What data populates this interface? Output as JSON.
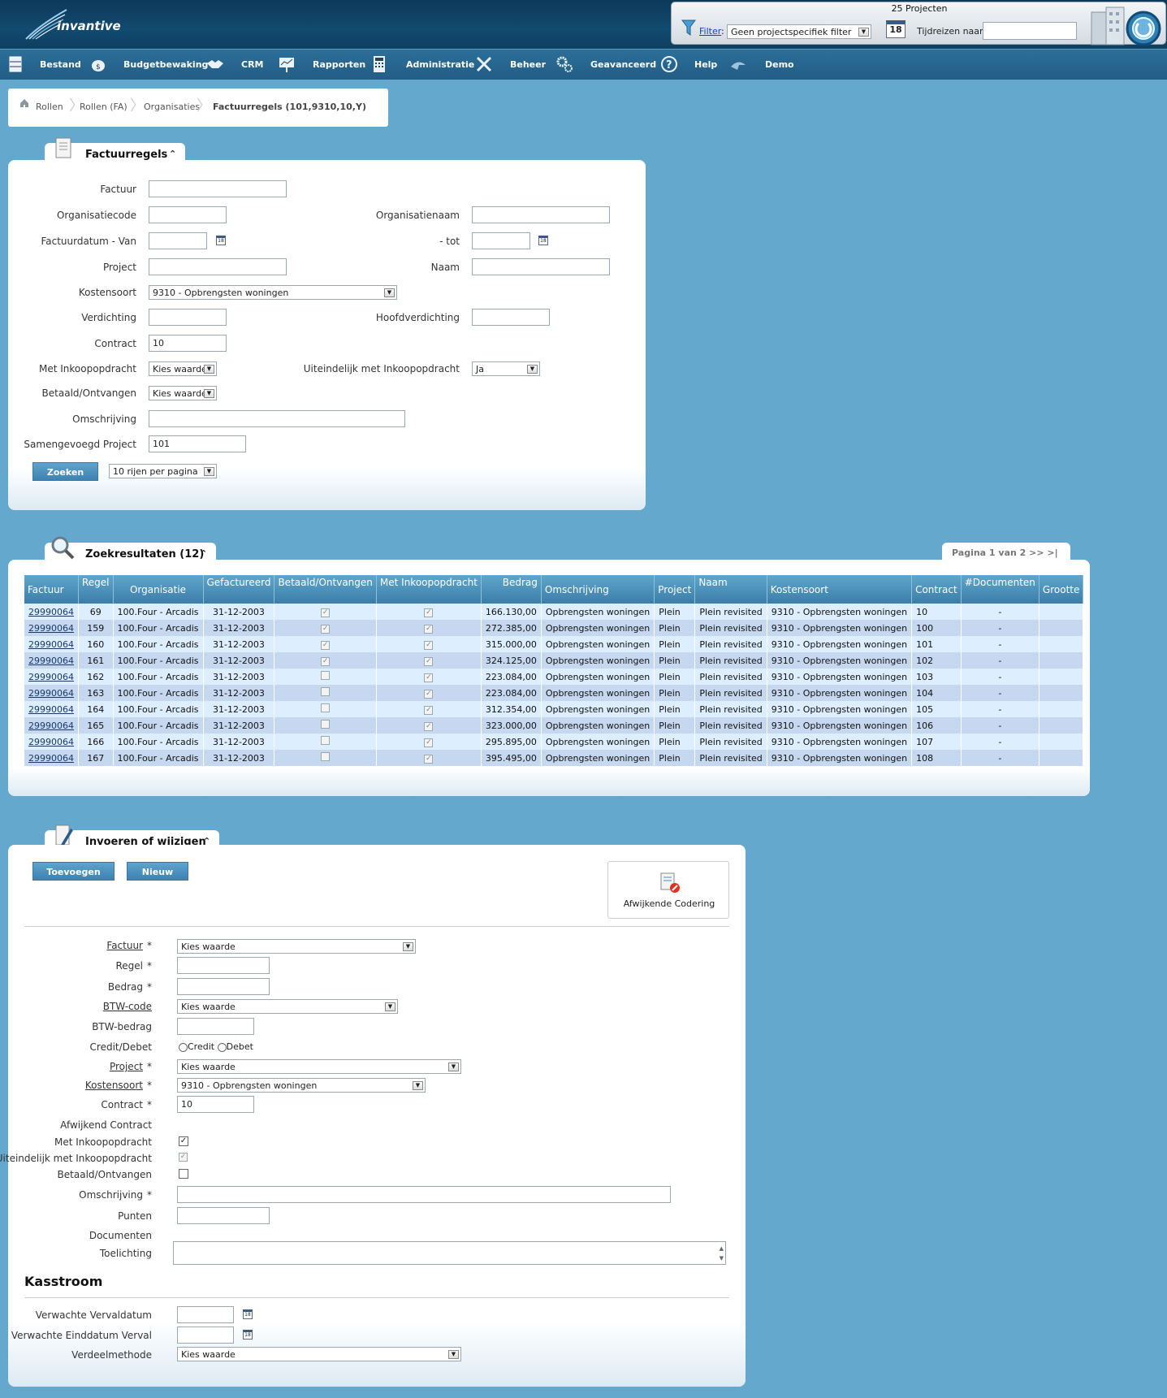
{
  "header": {
    "logo_text": "invantive",
    "project_count": "25 Projecten",
    "filter_link": "Filter",
    "filter_colon": ":",
    "filter_value": "Geen projectspecifiek filter",
    "calendar_day": "18",
    "timetravel_label": "Tijdreizen naar:"
  },
  "nav": {
    "items": [
      "Bestand",
      "Budgetbewaking",
      "CRM",
      "Rapporten",
      "Administratie",
      "Beheer",
      "Geavanceerd",
      "Help",
      "Demo"
    ]
  },
  "breadcrumb": {
    "items": [
      "Rollen",
      "Rollen (FA)",
      "Organisaties",
      "Factuurregels (101,9310,10,Y)"
    ]
  },
  "search_panel": {
    "title": "Factuurregels",
    "labels": {
      "factuur": "Factuur",
      "orgcode": "Organisatiecode",
      "orgnaam": "Organisatienaam",
      "datum_van": "Factuurdatum - Van",
      "datum_tot": "- tot",
      "project": "Project",
      "naam": "Naam",
      "kostensoort": "Kostensoort",
      "verdichting": "Verdichting",
      "hoofdverdichting": "Hoofdverdichting",
      "contract": "Contract",
      "met_inkoop": "Met Inkoopopdracht",
      "uiteindelijk": "Uiteindelijk met Inkoopopdracht",
      "betaald": "Betaald/Ontvangen",
      "omschrijving": "Omschrijving",
      "samengevoegd": "Samengevoegd Project"
    },
    "values": {
      "kostensoort": "9310 - Opbrengsten woningen",
      "contract": "10",
      "met_inkoop": "Kies waarde",
      "uiteindelijk": "Ja",
      "betaald": "Kies waarde",
      "samengevoegd": "101"
    },
    "search_button": "Zoeken",
    "rows_per_page": "10 rijen per pagina"
  },
  "results_panel": {
    "title": "Zoekresultaten (12)",
    "pagination": "Pagina 1 van 2 >> >|",
    "columns": [
      "Factuur",
      "Regel",
      "Organisatie",
      "Gefactureerd",
      "Betaald/Ontvangen",
      "Met Inkoopopdracht",
      "Bedrag",
      "Omschrijving",
      "Project",
      "Naam",
      "Kostensoort",
      "Contract",
      "#Documenten",
      "Grootte"
    ],
    "rows": [
      {
        "factuur": "29990064",
        "regel": "69",
        "organisatie": "100.Four - Arcadis",
        "gefactureerd": "31-12-2003",
        "betaald": true,
        "inkoop": true,
        "bedrag": "166.130,00",
        "omschrijving": "Opbrengsten woningen",
        "project": "Plein",
        "naam": "Plein revisited",
        "kostensoort": "9310 - Opbrengsten woningen",
        "contract": "10",
        "documenten": "-",
        "grootte": ""
      },
      {
        "factuur": "29990064",
        "regel": "159",
        "organisatie": "100.Four - Arcadis",
        "gefactureerd": "31-12-2003",
        "betaald": true,
        "inkoop": true,
        "bedrag": "272.385,00",
        "omschrijving": "Opbrengsten woningen",
        "project": "Plein",
        "naam": "Plein revisited",
        "kostensoort": "9310 - Opbrengsten woningen",
        "contract": "100",
        "documenten": "-",
        "grootte": ""
      },
      {
        "factuur": "29990064",
        "regel": "160",
        "organisatie": "100.Four - Arcadis",
        "gefactureerd": "31-12-2003",
        "betaald": true,
        "inkoop": true,
        "bedrag": "315.000,00",
        "omschrijving": "Opbrengsten woningen",
        "project": "Plein",
        "naam": "Plein revisited",
        "kostensoort": "9310 - Opbrengsten woningen",
        "contract": "101",
        "documenten": "-",
        "grootte": ""
      },
      {
        "factuur": "29990064",
        "regel": "161",
        "organisatie": "100.Four - Arcadis",
        "gefactureerd": "31-12-2003",
        "betaald": true,
        "inkoop": true,
        "bedrag": "324.125,00",
        "omschrijving": "Opbrengsten woningen",
        "project": "Plein",
        "naam": "Plein revisited",
        "kostensoort": "9310 - Opbrengsten woningen",
        "contract": "102",
        "documenten": "-",
        "grootte": ""
      },
      {
        "factuur": "29990064",
        "regel": "162",
        "organisatie": "100.Four - Arcadis",
        "gefactureerd": "31-12-2003",
        "betaald": false,
        "inkoop": true,
        "bedrag": "223.084,00",
        "omschrijving": "Opbrengsten woningen",
        "project": "Plein",
        "naam": "Plein revisited",
        "kostensoort": "9310 - Opbrengsten woningen",
        "contract": "103",
        "documenten": "-",
        "grootte": ""
      },
      {
        "factuur": "29990064",
        "regel": "163",
        "organisatie": "100.Four - Arcadis",
        "gefactureerd": "31-12-2003",
        "betaald": false,
        "inkoop": true,
        "bedrag": "223.084,00",
        "omschrijving": "Opbrengsten woningen",
        "project": "Plein",
        "naam": "Plein revisited",
        "kostensoort": "9310 - Opbrengsten woningen",
        "contract": "104",
        "documenten": "-",
        "grootte": ""
      },
      {
        "factuur": "29990064",
        "regel": "164",
        "organisatie": "100.Four - Arcadis",
        "gefactureerd": "31-12-2003",
        "betaald": false,
        "inkoop": true,
        "bedrag": "312.354,00",
        "omschrijving": "Opbrengsten woningen",
        "project": "Plein",
        "naam": "Plein revisited",
        "kostensoort": "9310 - Opbrengsten woningen",
        "contract": "105",
        "documenten": "-",
        "grootte": ""
      },
      {
        "factuur": "29990064",
        "regel": "165",
        "organisatie": "100.Four - Arcadis",
        "gefactureerd": "31-12-2003",
        "betaald": false,
        "inkoop": true,
        "bedrag": "323.000,00",
        "omschrijving": "Opbrengsten woningen",
        "project": "Plein",
        "naam": "Plein revisited",
        "kostensoort": "9310 - Opbrengsten woningen",
        "contract": "106",
        "documenten": "-",
        "grootte": ""
      },
      {
        "factuur": "29990064",
        "regel": "166",
        "organisatie": "100.Four - Arcadis",
        "gefactureerd": "31-12-2003",
        "betaald": false,
        "inkoop": true,
        "bedrag": "295.895,00",
        "omschrijving": "Opbrengsten woningen",
        "project": "Plein",
        "naam": "Plein revisited",
        "kostensoort": "9310 - Opbrengsten woningen",
        "contract": "107",
        "documenten": "-",
        "grootte": ""
      },
      {
        "factuur": "29990064",
        "regel": "167",
        "organisatie": "100.Four - Arcadis",
        "gefactureerd": "31-12-2003",
        "betaald": false,
        "inkoop": true,
        "bedrag": "395.495,00",
        "omschrijving": "Opbrengsten woningen",
        "project": "Plein",
        "naam": "Plein revisited",
        "kostensoort": "9310 - Opbrengsten woningen",
        "contract": "108",
        "documenten": "-",
        "grootte": ""
      }
    ]
  },
  "edit_panel": {
    "title": "Invoeren of wijzigen",
    "add_button": "Toevoegen",
    "new_button": "Nieuw",
    "alt_coding_button": "Afwijkende Codering",
    "labels": {
      "factuur": "Factuur",
      "regel": "Regel",
      "bedrag": "Bedrag",
      "btw_code": "BTW-code",
      "btw_bedrag": "BTW-bedrag",
      "credit_debet": "Credit/Debet",
      "project": "Project",
      "kostensoort": "Kostensoort",
      "contract": "Contract",
      "afwijkend_contract": "Afwijkend Contract",
      "met_inkoop": "Met Inkoopopdracht",
      "uiteindelijk": "Uiteindelijk met Inkoopopdracht",
      "betaald": "Betaald/Ontvangen",
      "omschrijving": "Omschrijving",
      "punten": "Punten",
      "documenten": "Documenten",
      "toelichting": "Toelichting"
    },
    "required_mark": "*",
    "values": {
      "factuur": "Kies waarde",
      "btw_code": "Kies waarde",
      "project": "Kies waarde",
      "kostensoort": "9310 - Opbrengsten woningen",
      "contract": "10"
    },
    "radio_credit": "Credit",
    "radio_debet": "Debet",
    "checks": {
      "met_inkoop": true,
      "uiteindelijk": true,
      "betaald": false
    },
    "kasstroom": {
      "heading": "Kasstroom",
      "vervaldatum": "Verwachte Vervaldatum",
      "einddatum": "Verwachte Einddatum Verval",
      "verdeelmethode": "Verdeelmethode",
      "verdeelmethode_value": "Kies waarde"
    }
  },
  "icons": [
    "filter-icon",
    "calendar-icon",
    "building-icon",
    "home-icon",
    "document-icon",
    "search-icon",
    "pencil-icon",
    "alt-coding-icon"
  ],
  "colors": {
    "background": "#64a8ce",
    "header": "#0c3958",
    "nav": "#2c6f99",
    "table_header": "#4a90bb",
    "row_even": "#dceeff",
    "row_odd": "#c6d8f0"
  }
}
